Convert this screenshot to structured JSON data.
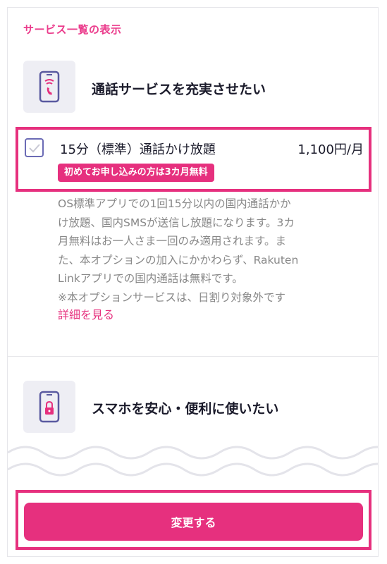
{
  "header": {
    "link_label": "サービス一覧の表示"
  },
  "services": [
    {
      "title": "通話サービスを充実させたい",
      "icon": "phone-call-icon"
    },
    {
      "title": "スマホを安心・便利に使いたい",
      "icon": "phone-lock-icon"
    }
  ],
  "option": {
    "name": "15分（標準）通話かけ放題",
    "price": "1,100円/月",
    "promo": "初めてお申し込みの方は3カ月無料",
    "checked": false,
    "description_lines": [
      "OS標準アプリでの1回15分以内の国内通話かか",
      "け放題、国内SMSが送信し放題になります。3カ",
      "月無料はお一人さま一回のみ適用されます。ま",
      "た、本オプションの加入にかかわらず、Rakuten",
      "Linkアプリでの国内通話は無料です。",
      "※本オプションサービスは、日割り対象外です"
    ],
    "details_link": "詳細を見る"
  },
  "footer": {
    "submit_label": "変更する"
  },
  "colors": {
    "accent": "#e6307e",
    "icon_bg": "#eeeef4",
    "checkbox_border": "#6b6bb5"
  }
}
